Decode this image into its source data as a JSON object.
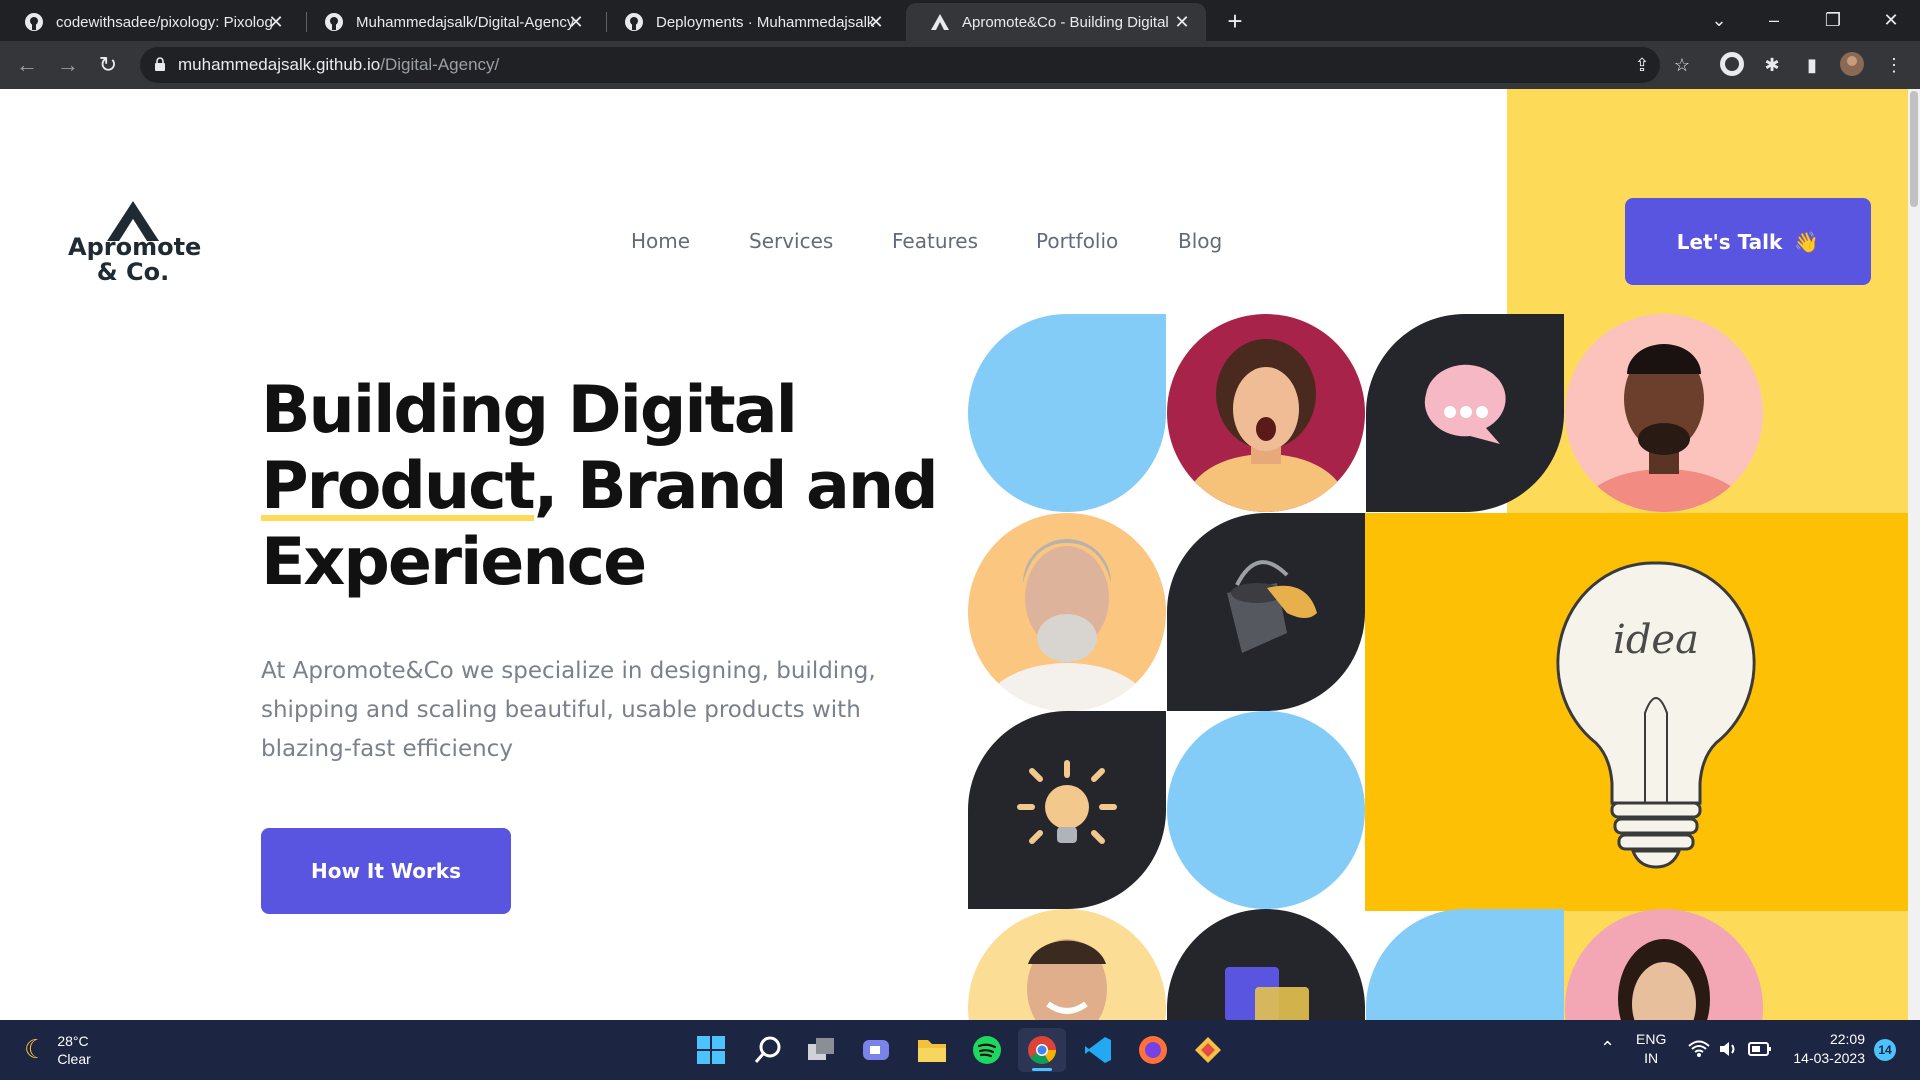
{
  "browser": {
    "tabs": [
      {
        "title": "codewithsadee/pixology: Pixolog",
        "icon": "github-icon"
      },
      {
        "title": "Muhammedajsalk/Digital-Agency",
        "icon": "github-icon"
      },
      {
        "title": "Deployments · Muhammedajsalk",
        "icon": "github-icon"
      },
      {
        "title": "Apromote&Co - Building Digital",
        "icon": "apromote-logo-icon"
      }
    ],
    "new_tab": "+",
    "url_host": "muhammedajsalk.github.io",
    "url_path": "/Digital-Agency/"
  },
  "site": {
    "logo_line1": "Apromote",
    "logo_line2": "& Co.",
    "nav": [
      "Home",
      "Services",
      "Features",
      "Portfolio",
      "Blog"
    ],
    "cta_label": "Let's Talk",
    "cta_emoji": "👋",
    "headline": {
      "line1": "Building Digital",
      "line2_underlined": "Product",
      "line2_rest": ", Brand and",
      "line3": "Experience"
    },
    "lead": "At Apromote&Co we specialize in designing, building, shipping and scaling beautiful, usable products with blazing-fast efficiency",
    "how_label": "How It Works",
    "colors": {
      "accent": "#5a55e1",
      "yellow": "#fddb59",
      "dark": "#25262b",
      "blue": "#84ccf8",
      "amber": "#fdc005"
    }
  },
  "taskbar": {
    "weather_temp": "28°C",
    "weather_desc": "Clear",
    "lang1": "ENG",
    "lang2": "IN",
    "time": "22:09",
    "date": "14-03-2023",
    "notifications": "14"
  }
}
